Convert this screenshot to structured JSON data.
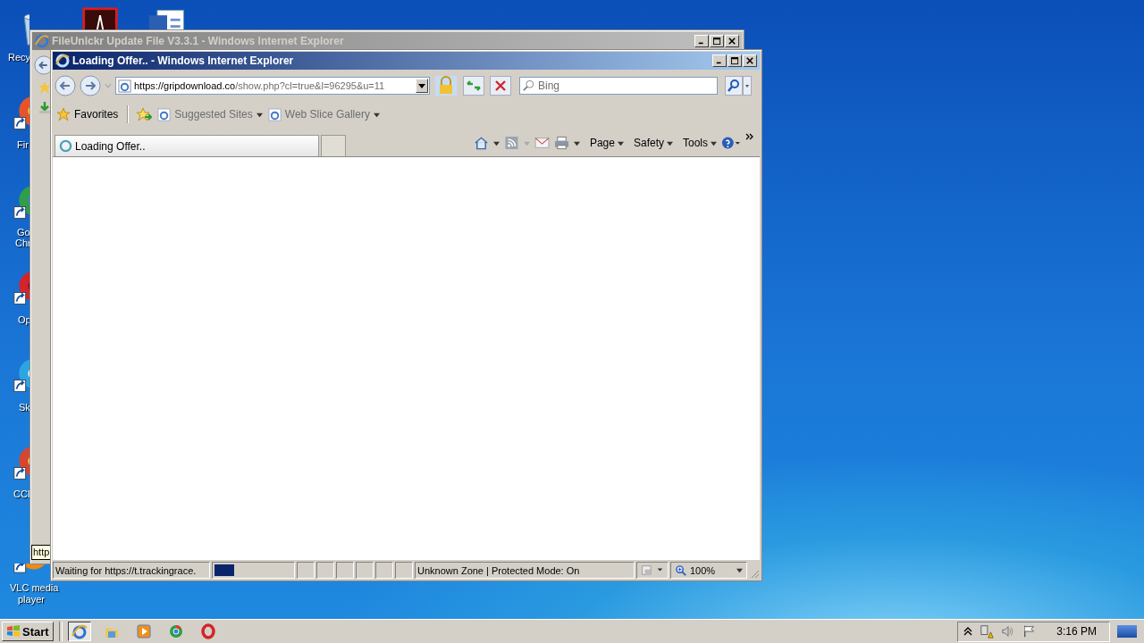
{
  "desktop_icons": [
    {
      "kind": "recycle",
      "lines": [
        "Recy"
      ]
    },
    {
      "kind": "pdf"
    },
    {
      "kind": "word"
    },
    {
      "kind": "firefox",
      "lines": [
        "Fir"
      ]
    },
    {
      "kind": "chrome",
      "lines": [
        "Go",
        "Chr"
      ]
    },
    {
      "kind": "opera",
      "lines": [
        "Op"
      ]
    },
    {
      "kind": "skype",
      "lines": [
        "Sk"
      ]
    },
    {
      "kind": "ccleaner",
      "lines": [
        "CCl"
      ]
    },
    {
      "kind": "vlc",
      "lines": [
        "VLC media",
        "player"
      ]
    }
  ],
  "back_window": {
    "title": "FileUnlckr Update File V3.3.1 - Windows Internet Explorer",
    "tooltip": "http"
  },
  "window": {
    "title": "Loading Offer.. - Windows Internet Explorer",
    "address": {
      "host": "https://gripdownload.co",
      "path": "/show.php?cl=true&l=96295&u=11"
    },
    "search": {
      "placeholder": "Bing"
    },
    "favorites_bar": {
      "favorites": "Favorites",
      "items": [
        "Suggested Sites",
        "Web Slice Gallery"
      ]
    },
    "tab": {
      "title": "Loading Offer.."
    },
    "command_bar": [
      "Page",
      "Safety",
      "Tools"
    ],
    "status_bar": {
      "text": "Waiting for https://t.trackingrace.",
      "level": 0.25,
      "zone": "Unknown Zone | Protected Mode: On",
      "zoom": "100%"
    }
  },
  "taskbar": {
    "start": "Start",
    "apps": [
      {
        "kind": "ie",
        "selected": true
      },
      {
        "kind": "folder",
        "selected": false
      },
      {
        "kind": "media",
        "selected": false
      },
      {
        "kind": "chrome",
        "selected": false
      },
      {
        "kind": "opera",
        "selected": false
      }
    ],
    "clock": "3:16 PM"
  }
}
